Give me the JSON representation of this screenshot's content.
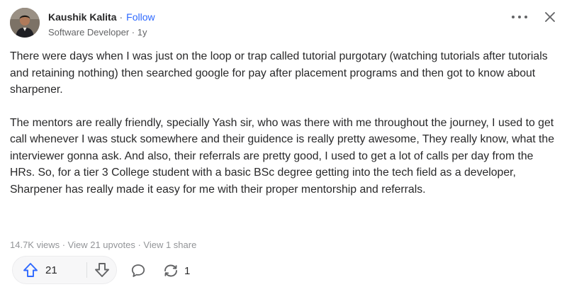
{
  "author": {
    "name": "Kaushik Kalita",
    "separator": "·",
    "follow_label": "Follow",
    "credential": "Software Developer",
    "age": "1y"
  },
  "header_actions": {
    "more_icon": "more-horizontal-icon",
    "close_icon": "close-icon"
  },
  "answer": {
    "paragraphs": [
      "There were days when I was just on the loop or trap called tutorial purgotary (watching tutorials after tutorials and retaining nothing) then searched google for pay after placement programs and then got to know about sharpener.",
      "The mentors are really friendly, specially Yash sir, who was there with me throughout the journey, I used to get call whenever I was stuck somewhere and their guidence is really pretty awesome, They really know, what the interviewer gonna ask. And also, their referrals are pretty good, I used to get a lot of calls per day from the HRs. So, for a tier 3 College student with a basic BSc degree getting into the tech field as a developer, Sharpener has really made it easy for me with their proper mentorship and referrals."
    ]
  },
  "stats": {
    "views": "14.7K views",
    "upvotes": "View 21 upvotes",
    "shares": "View 1 share",
    "separator": " · "
  },
  "actions": {
    "upvote_count": "21",
    "share_count": "1",
    "upvote_icon": "upvote-arrow-icon",
    "downvote_icon": "downvote-arrow-icon",
    "comment_icon": "comment-bubble-icon",
    "share_icon": "share-arrows-icon"
  },
  "colors": {
    "accent": "#2e69ff",
    "text": "#282829",
    "muted": "#636466",
    "stats": "#939598",
    "vote_bg": "#f7f7f8"
  }
}
